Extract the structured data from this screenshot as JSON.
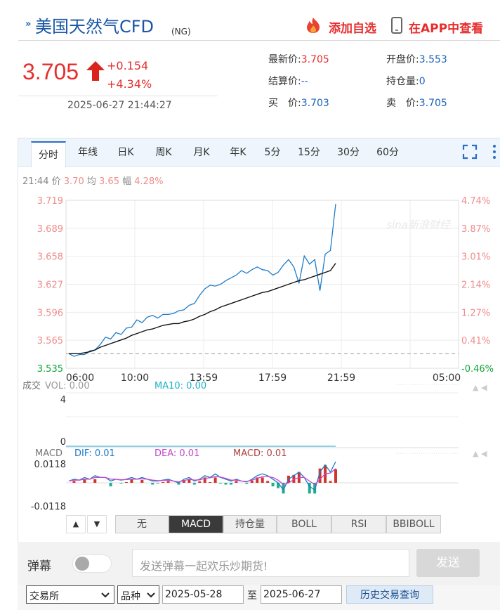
{
  "header": {
    "name": "美国天然气CFD",
    "code": "(NG)",
    "add_watch": "添加自选",
    "app_view": "在APP中查看"
  },
  "quote": {
    "price": "3.705",
    "change": "+0.154",
    "change_pct": "+4.34%",
    "datetime": "2025-06-27 21:44:27"
  },
  "stats": [
    {
      "label": "最新价:",
      "value": "3.705",
      "color": "#e62e2e"
    },
    {
      "label": "开盘价:",
      "value": "3.553",
      "color": "#1a62b8"
    },
    {
      "label": "结算价:",
      "value": "--",
      "color": "#1a62b8"
    },
    {
      "label": "持仓量:",
      "value": "0",
      "color": "#1a62b8"
    },
    {
      "label": "买　价:",
      "value": "3.703",
      "color": "#1a62b8"
    },
    {
      "label": "卖　价:",
      "value": "3.705",
      "color": "#1a62b8"
    }
  ],
  "tabs": [
    {
      "label": "分时",
      "active": true
    },
    {
      "label": "年线"
    },
    {
      "label": "日K"
    },
    {
      "label": "周K"
    },
    {
      "label": "月K"
    },
    {
      "label": "年K"
    },
    {
      "label": "5分"
    },
    {
      "label": "15分"
    },
    {
      "label": "30分"
    },
    {
      "label": "60分"
    }
  ],
  "info_line": {
    "time": "21:44",
    "price_label": "价",
    "price": "3.70",
    "avg_label": "均",
    "avg": "3.65",
    "amp_label": "幅",
    "amp": "4.28%"
  },
  "watermark": "sina新浪财经",
  "chart_data": {
    "type": "line",
    "x_ticks": [
      "06:00",
      "10:00",
      "13:59",
      "17:59",
      "21:59",
      "05:00"
    ],
    "y_left_ticks": [
      "3.719",
      "3.689",
      "3.658",
      "3.627",
      "3.596",
      "3.565",
      "3.535"
    ],
    "y_right_ticks": [
      "4.74%",
      "3.87%",
      "3.01%",
      "2.14%",
      "1.27%",
      "0.41%",
      "-0.46%"
    ],
    "ylim": [
      3.535,
      3.719
    ],
    "prev_settle": 3.551,
    "series": [
      {
        "role": "price",
        "color": "#1e7cc8",
        "values": [
          3.551,
          3.548,
          3.55,
          3.55,
          3.554,
          3.555,
          3.561,
          3.569,
          3.567,
          3.574,
          3.572,
          3.579,
          3.58,
          3.588,
          3.585,
          3.591,
          3.593,
          3.59,
          3.594,
          3.594,
          3.595,
          3.598,
          3.599,
          3.604,
          3.606,
          3.615,
          3.622,
          3.626,
          3.625,
          3.627,
          3.631,
          3.634,
          3.637,
          3.642,
          3.639,
          3.643,
          3.646,
          3.643,
          3.642,
          3.637,
          3.64,
          3.648,
          3.654,
          3.646,
          3.628,
          3.658,
          3.649,
          3.654,
          3.62,
          3.66,
          3.664,
          3.715
        ]
      },
      {
        "role": "average",
        "color": "#111111",
        "values": [
          3.551,
          3.551,
          3.551,
          3.552,
          3.553,
          3.555,
          3.558,
          3.56,
          3.562,
          3.564,
          3.566,
          3.568,
          3.571,
          3.573,
          3.575,
          3.577,
          3.578,
          3.58,
          3.582,
          3.583,
          3.584,
          3.584,
          3.586,
          3.587,
          3.589,
          3.592,
          3.594,
          3.597,
          3.599,
          3.602,
          3.604,
          3.606,
          3.608,
          3.61,
          3.612,
          3.614,
          3.616,
          3.618,
          3.619,
          3.621,
          3.623,
          3.625,
          3.627,
          3.629,
          3.631,
          3.632,
          3.634,
          3.636,
          3.638,
          3.64,
          3.642,
          3.65
        ]
      }
    ]
  },
  "volume": {
    "title": "成交",
    "vol_label": "VOL: 0.00",
    "ma_label": "MA10: 0.00",
    "max": "4",
    "min": "0"
  },
  "macd": {
    "title": "MACD",
    "dif": "DIF: 0.01",
    "dea": "DEA: 0.01",
    "macd": "MACD: 0.01",
    "max": "0.0118",
    "min": "-0.0118",
    "dif_values": [
      0.001,
      0.002,
      0.0015,
      0.003,
      0.002,
      0.004,
      0.003,
      0.003,
      0.001,
      0.002,
      0.0015,
      0.002,
      0.003,
      0.002,
      0.003,
      0.002,
      0.001,
      0.001,
      0.0015,
      0.002,
      0.001,
      0,
      0.002,
      0.003,
      0.001,
      0.002,
      0.004,
      0.003,
      0.005,
      0.003,
      0.002,
      0.001,
      0.002,
      0.001,
      0.0005,
      0.002,
      0.004,
      0.005,
      0.004,
      0.002,
      0,
      -0.004,
      0.002,
      0.004,
      0.006,
      0.003,
      -0.002,
      -0.004,
      0.006,
      0.01,
      0.006,
      0.0118
    ],
    "dea_values": [
      0.001,
      0.0015,
      0.0015,
      0.002,
      0.002,
      0.003,
      0.003,
      0.003,
      0.002,
      0.002,
      0.0017,
      0.0018,
      0.002,
      0.002,
      0.0022,
      0.002,
      0.0015,
      0.0012,
      0.0013,
      0.0015,
      0.001,
      0.0005,
      0.0012,
      0.002,
      0.0015,
      0.0016,
      0.0025,
      0.0028,
      0.0035,
      0.0032,
      0.0025,
      0.0015,
      0.0015,
      0.001,
      0.0008,
      0.0014,
      0.0025,
      0.0035,
      0.0035,
      0.003,
      0.0015,
      -0.001,
      0,
      0.0018,
      0.003,
      0.003,
      0.001,
      -0.001,
      0.002,
      0.005,
      0.0055,
      0.008
    ],
    "buttons": [
      "无",
      "MACD",
      "持仓量",
      "BOLL",
      "RSI",
      "BBIBOLL"
    ],
    "active": "MACD"
  },
  "danmu": {
    "label": "弹幕",
    "placeholder": "发送弹幕一起欢乐炒期货!",
    "send": "发送"
  },
  "history": {
    "exchange": "交易所",
    "variety": "品种",
    "date_from": "2025-05-28",
    "to_label": "至",
    "date_to": "2025-06-27",
    "query": "历史交易查询"
  },
  "colors": {
    "up": "#e62e2e",
    "down": "#11a33a",
    "blue": "#1a62b8",
    "price_line": "#1e7cc8",
    "dif": "#1e7cc8",
    "dea": "#c548c9"
  }
}
